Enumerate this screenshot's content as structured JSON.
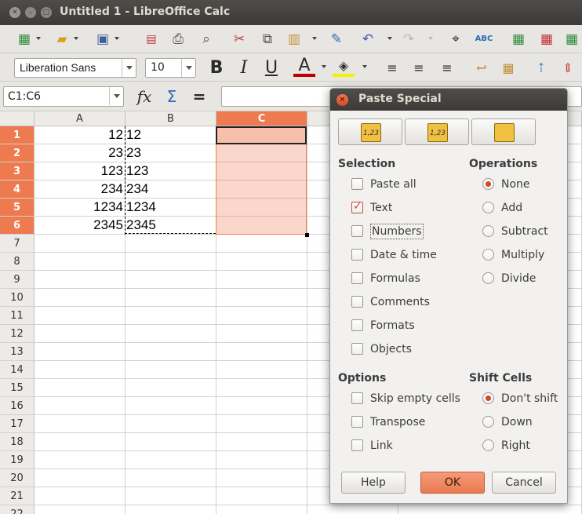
{
  "window": {
    "title": "Untitled 1 - LibreOffice Calc"
  },
  "toolbar": {
    "font_name": "Liberation Sans",
    "font_size": "10",
    "bold_label": "B",
    "italic_label": "I",
    "underline_label": "U",
    "spelling_label": "ABC"
  },
  "formula_bar": {
    "name_box": "C1:C6",
    "function_wizard_label": "fx",
    "sum_label": "Σ",
    "formula_label": "="
  },
  "sheet": {
    "columns": [
      "A",
      "B",
      "C"
    ],
    "selected_column": "C",
    "rows": [
      "1",
      "2",
      "3",
      "4",
      "5",
      "6",
      "7",
      "8",
      "9",
      "10",
      "11",
      "12",
      "13",
      "14",
      "15",
      "16",
      "17",
      "18",
      "19",
      "20",
      "21",
      "22"
    ],
    "col_a": [
      "12",
      "23",
      "123",
      "234",
      "1234",
      "2345"
    ],
    "col_b": [
      "12",
      "23",
      "123",
      "234",
      "1234",
      "2345"
    ]
  },
  "dialog": {
    "title": "Paste Special",
    "preset_labels": [
      "1,23",
      "1,23",
      ""
    ],
    "selection": {
      "title": "Selection",
      "items": [
        {
          "label": "Paste all",
          "checked": false
        },
        {
          "label": "Text",
          "checked": true
        },
        {
          "label": "Numbers",
          "checked": false
        },
        {
          "label": "Date & time",
          "checked": false
        },
        {
          "label": "Formulas",
          "checked": false
        },
        {
          "label": "Comments",
          "checked": false
        },
        {
          "label": "Formats",
          "checked": false
        },
        {
          "label": "Objects",
          "checked": false
        }
      ]
    },
    "operations": {
      "title": "Operations",
      "items": [
        {
          "label": "None",
          "selected": true
        },
        {
          "label": "Add",
          "selected": false
        },
        {
          "label": "Subtract",
          "selected": false
        },
        {
          "label": "Multiply",
          "selected": false
        },
        {
          "label": "Divide",
          "selected": false
        }
      ]
    },
    "options": {
      "title": "Options",
      "items": [
        {
          "label": "Skip empty cells",
          "checked": false
        },
        {
          "label": "Transpose",
          "checked": false
        },
        {
          "label": "Link",
          "checked": false
        }
      ]
    },
    "shift_cells": {
      "title": "Shift Cells",
      "items": [
        {
          "label": "Don't shift",
          "selected": true
        },
        {
          "label": "Down",
          "selected": false
        },
        {
          "label": "Right",
          "selected": false
        }
      ]
    },
    "buttons": {
      "help": "Help",
      "ok": "OK",
      "cancel": "Cancel"
    }
  },
  "colors": {
    "accent": "#ee7a4f",
    "titlebar": "#3c3b37",
    "check": "#d0482a"
  }
}
